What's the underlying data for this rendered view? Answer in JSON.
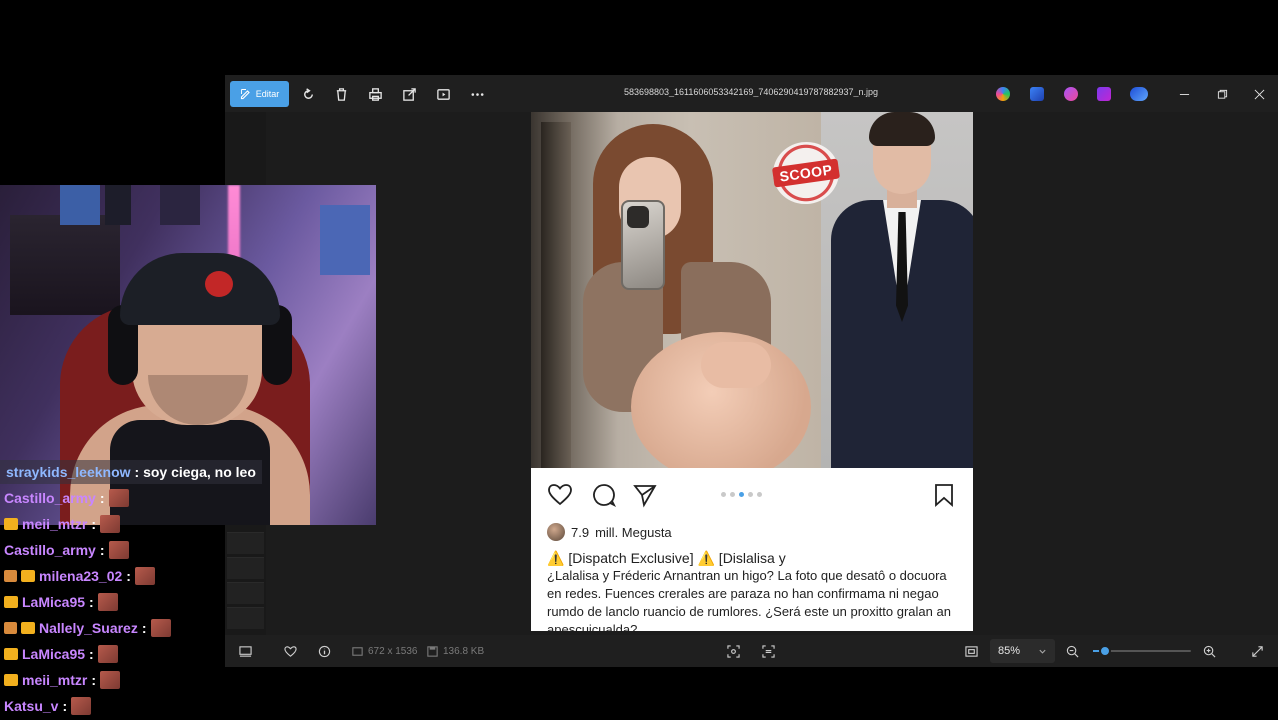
{
  "viewer": {
    "edit_label": "Editar",
    "filename": "583698803_1611606053342169_7406290419787882937_n.jpg",
    "toolbar_icons": [
      "rotate-icon",
      "delete-icon",
      "print-icon",
      "share-icon",
      "slideshow-icon",
      "more-icon"
    ],
    "app_icons": [
      "copilot-icon",
      "designer-icon",
      "clipchamp-icon",
      "clipchamp-alt-icon",
      "onedrive-icon"
    ],
    "image_dims": "672 x 1536",
    "file_size": "136.8 KB",
    "zoom": "85%",
    "zoom_level": 0.12,
    "accent": "#4aa0e6"
  },
  "post": {
    "scoop_label": "SCOOP",
    "likes_count": "7.9",
    "likes_suffix": "mill. Megusta",
    "caption_line1": "⚠️ [Dispatch Exclusive] ⚠️ [Dislalisa y",
    "caption_body": "¿Lalalisa y Fréderic Arnantran un higo? La foto que desatô o docuora en redes. Fuences crerales are paraza no han confirmama ni negao rumdo de lanclo ruancio de rumlores. ¿Será este un proxitto gralan an apescuicualda?",
    "carousel_dots": 5,
    "carousel_active": 2
  },
  "chat": [
    {
      "user": "straykids_leeknow",
      "color": "#8fb8ff",
      "msg": ": soy ciega, no leo",
      "badges": []
    },
    {
      "user": "Castillo_army",
      "color": "#c886ff",
      "msg": ":",
      "badges": []
    },
    {
      "user": "meii_mtzr",
      "color": "#c886ff",
      "msg": ":",
      "badges": [
        "crown"
      ]
    },
    {
      "user": "Castillo_army",
      "color": "#c886ff",
      "msg": ":",
      "badges": []
    },
    {
      "user": "milena23_02",
      "color": "#c886ff",
      "msg": ":",
      "badges": [
        "cat",
        "crown"
      ]
    },
    {
      "user": "LaMica95",
      "color": "#c886ff",
      "msg": ":",
      "badges": [
        "crown"
      ]
    },
    {
      "user": "Nallely_Suarez",
      "color": "#c886ff",
      "msg": ":",
      "badges": [
        "figure",
        "crown"
      ]
    },
    {
      "user": "LaMica95",
      "color": "#c886ff",
      "msg": ":",
      "badges": [
        "crown"
      ]
    },
    {
      "user": "meii_mtzr",
      "color": "#c886ff",
      "msg": ":",
      "badges": [
        "crown"
      ]
    },
    {
      "user": "Katsu_v",
      "color": "#c886ff",
      "msg": ":",
      "badges": []
    }
  ]
}
